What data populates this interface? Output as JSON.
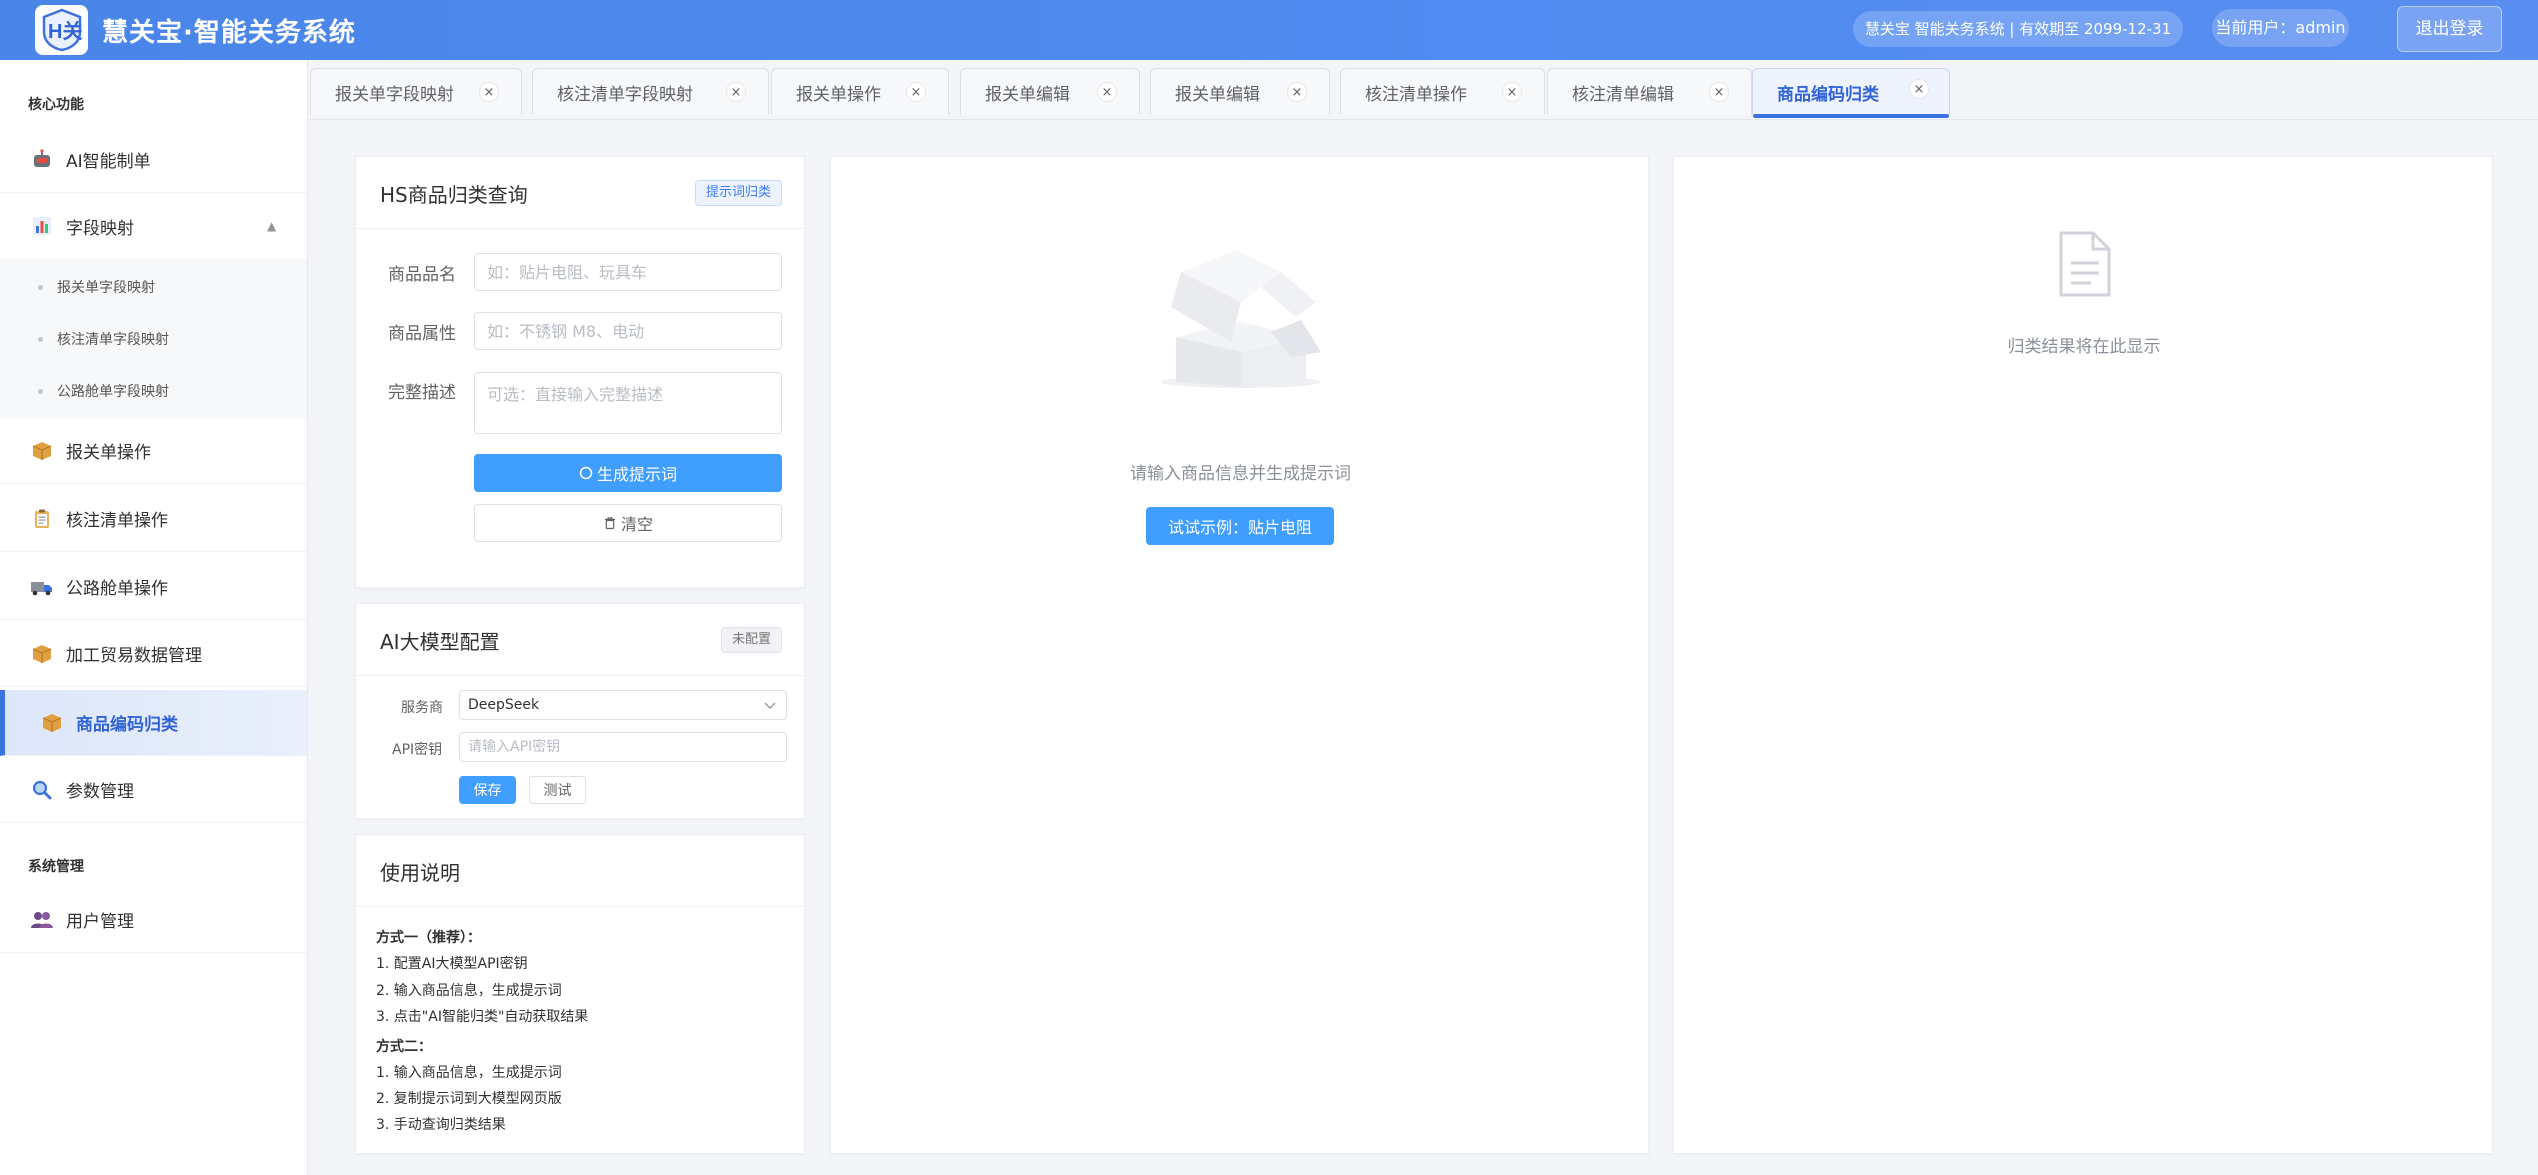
{
  "header": {
    "logo_text": "H关",
    "title": "慧关宝·智能关务系统",
    "license_info": "慧关宝 智能关务系统 | 有效期至 2099-12-31",
    "current_user": "当前用户：admin",
    "logout_label": "退出登录"
  },
  "sidebar": {
    "section_core": "核心功能",
    "section_system": "系统管理",
    "items": [
      {
        "label": "AI智能制单",
        "icon": "robot-icon"
      },
      {
        "label": "字段映射",
        "icon": "bar-chart-icon",
        "expanded": true
      },
      {
        "label": "报关单操作",
        "icon": "package-icon"
      },
      {
        "label": "核注清单操作",
        "icon": "clipboard-icon"
      },
      {
        "label": "公路舱单操作",
        "icon": "truck-icon"
      },
      {
        "label": "加工贸易数据管理",
        "icon": "package-icon"
      },
      {
        "label": "商品编码归类",
        "icon": "package-icon",
        "active": true
      },
      {
        "label": "参数管理",
        "icon": "magnifier-icon"
      },
      {
        "label": "用户管理",
        "icon": "users-icon"
      }
    ],
    "subitems": [
      {
        "label": "报关单字段映射"
      },
      {
        "label": "核注清单字段映射"
      },
      {
        "label": "公路舱单字段映射"
      }
    ]
  },
  "tabs": [
    {
      "label": "报关单字段映射"
    },
    {
      "label": "核注清单字段映射"
    },
    {
      "label": "报关单操作"
    },
    {
      "label": "报关单编辑"
    },
    {
      "label": "报关单编辑"
    },
    {
      "label": "核注清单操作"
    },
    {
      "label": "核注清单编辑"
    },
    {
      "label": "商品编码归类",
      "active": true
    }
  ],
  "hs_query": {
    "title": "HS商品归类查询",
    "badge": "提示词归类",
    "name_label": "商品品名",
    "name_placeholder": "如：贴片电阻、玩具车",
    "attr_label": "商品属性",
    "attr_placeholder": "如：不锈钢 M8、电动",
    "desc_label": "完整描述",
    "desc_placeholder": "可选：直接输入完整描述",
    "generate_label": "生成提示词",
    "clear_label": "清空"
  },
  "ai_config": {
    "title": "AI大模型配置",
    "badge": "未配置",
    "provider_label": "服务商",
    "provider_value": "DeepSeek",
    "api_label": "API密钥",
    "api_placeholder": "请输入API密钥",
    "save_label": "保存",
    "test_label": "测试"
  },
  "instructions": {
    "title": "使用说明",
    "lines": [
      "方式一（推荐）：",
      "1. 配置AI大模型API密钥",
      "2. 输入商品信息，生成提示词",
      "3. 点击\"AI智能归类\"自动获取结果",
      "方式二：",
      "1. 输入商品信息，生成提示词",
      "2. 复制提示词到大模型网页版",
      "3. 手动查询归类结果"
    ]
  },
  "prompt_panel": {
    "empty_text": "请输入商品信息并生成提示词",
    "example_label": "试试示例：贴片电阻"
  },
  "result_panel": {
    "empty_text": "归类结果将在此显示"
  },
  "colors": {
    "header_blue": "#4a86e8",
    "primary": "#409eff",
    "active_menu": "#2f63d6"
  }
}
